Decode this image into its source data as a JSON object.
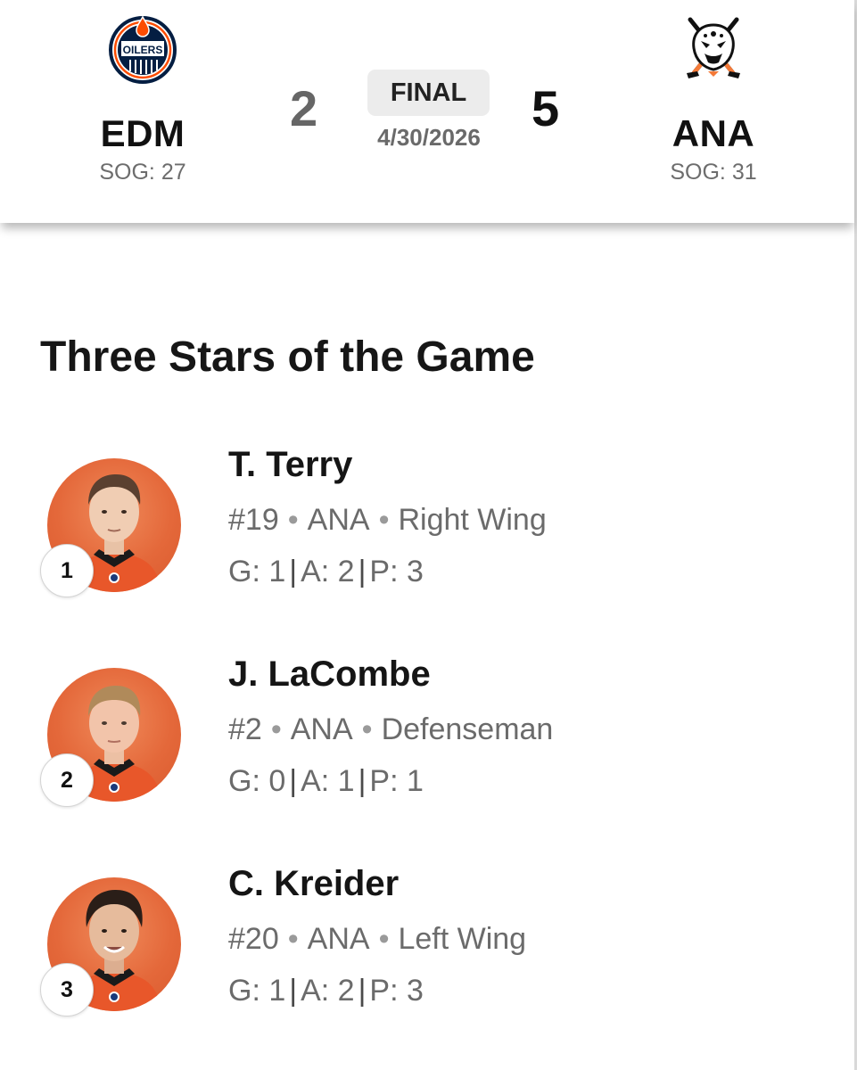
{
  "game": {
    "away": {
      "abbr": "EDM",
      "sog": "SOG: 27",
      "score": "2",
      "logo_icon": "oilers-logo-icon",
      "logo_text": "OILERS"
    },
    "home": {
      "abbr": "ANA",
      "sog": "SOG: 31",
      "score": "5",
      "logo_icon": "ducks-logo-icon"
    },
    "status": "FINAL",
    "date": "4/30/2026"
  },
  "colors": {
    "oilers_blue": "#041e42",
    "oilers_orange": "#fc4c02",
    "ducks_orange": "#f47a38",
    "headshot_bg": "#e4683a"
  },
  "three_stars": {
    "title": "Three Stars of the Game",
    "separator": "•",
    "players": [
      {
        "rank": "1",
        "name": "T. Terry",
        "number": "#19",
        "team": "ANA",
        "position": "Right Wing",
        "g": "G: 1",
        "a": "A: 2",
        "p": "P: 3"
      },
      {
        "rank": "2",
        "name": "J. LaCombe",
        "number": "#2",
        "team": "ANA",
        "position": "Defenseman",
        "g": "G: 0",
        "a": "A: 1",
        "p": "P: 1"
      },
      {
        "rank": "3",
        "name": "C. Kreider",
        "number": "#20",
        "team": "ANA",
        "position": "Left Wing",
        "g": "G: 1",
        "a": "A: 2",
        "p": "P: 3"
      }
    ]
  }
}
